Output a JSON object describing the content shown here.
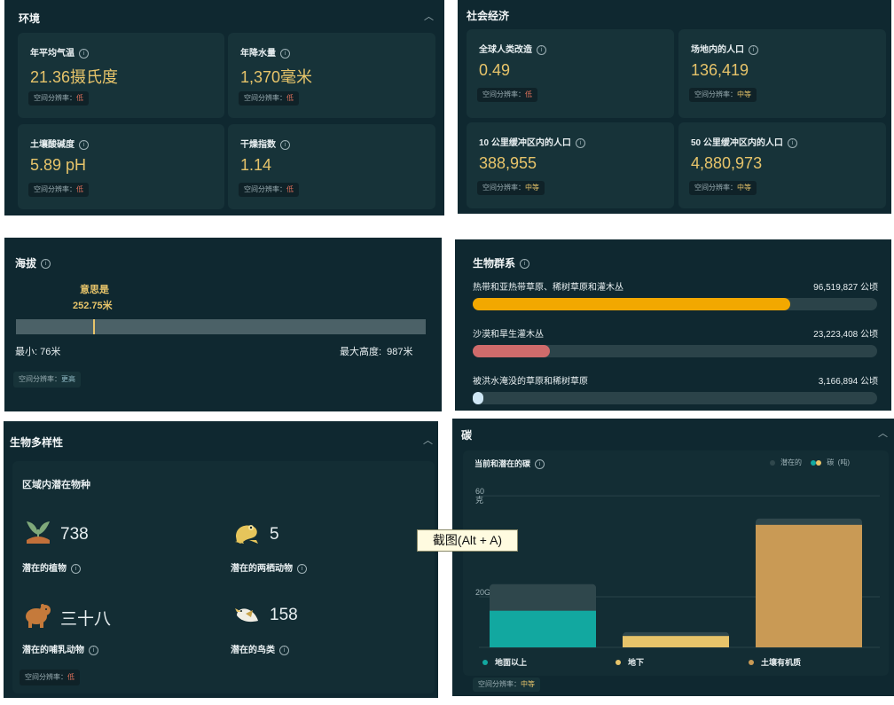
{
  "environment": {
    "title": "环境",
    "cards": [
      {
        "label": "年平均气温",
        "value": "21.36摄氏度",
        "res_label": "空间分辨率：",
        "res_level": "低"
      },
      {
        "label": "年降水量",
        "value": "1,370毫米",
        "res_label": "空间分辨率：",
        "res_level": "低"
      },
      {
        "label": "土壤酸碱度",
        "value": "5.89 pH",
        "res_label": "空间分辨率：",
        "res_level": "低"
      },
      {
        "label": "干燥指数",
        "value": "1.14",
        "res_label": "空间分辨率：",
        "res_level": "低"
      }
    ]
  },
  "socioeconomic": {
    "title": "社会经济",
    "cards": [
      {
        "label": "全球人类改造",
        "value": "0.49",
        "res_label": "空间分辨率：",
        "res_level": "低"
      },
      {
        "label": "场地内的人口",
        "value": "136,419",
        "res_label": "空间分辨率：",
        "res_level": "中等"
      },
      {
        "label": "10 公里缓冲区内的人口",
        "value": "388,955",
        "res_label": "空间分辨率：",
        "res_level": "中等"
      },
      {
        "label": "50 公里缓冲区内的人口",
        "value": "4,880,973",
        "res_label": "空间分辨率：",
        "res_level": "中等"
      }
    ]
  },
  "elevation": {
    "title": "海拔",
    "mean_label": "意思是",
    "mean_value": "252.75米",
    "mean_fraction": 0.19,
    "min_label": "最小: 76米",
    "max_label": "最大高度:  987米",
    "res_label": "空间分辨率：",
    "res_level": "更高"
  },
  "biome": {
    "title": "生物群系",
    "rows": [
      {
        "label": "热带和亚热带草原、稀树草原和灌木丛",
        "value": "96,519,827 公顷",
        "fraction": 0.785,
        "color": "#f2a800"
      },
      {
        "label": "沙漠和旱生灌木丛",
        "value": "23,223,408 公顷",
        "fraction": 0.19,
        "color": "#cf6b6b"
      },
      {
        "label": "被洪水淹没的草原和稀树草原",
        "value": "3,166,894 公顷",
        "fraction": 0.026,
        "color": "#cfe7f5"
      }
    ]
  },
  "biodiversity": {
    "title": "生物多样性",
    "subtitle": "区域内潜在物种",
    "items": [
      {
        "count": "738",
        "label": "潜在的植物",
        "icon": "plant-icon"
      },
      {
        "count": "5",
        "label": "潜在的两栖动物",
        "icon": "frog-icon"
      },
      {
        "count": "三十八",
        "label": "潜在的哺乳动物",
        "icon": "bear-icon"
      },
      {
        "count": "158",
        "label": "潜在的鸟类",
        "icon": "bird-icon"
      }
    ],
    "res_label": "空间分辨率：",
    "res_level": "低"
  },
  "carbon": {
    "title": "碳",
    "chart_title": "当前和潜在的碳",
    "legend_potential": "潜在的",
    "legend_carbon": "碳  (吨)",
    "res_label": "空间分辨率：",
    "res_level": "中等",
    "chart_data": {
      "type": "bar",
      "categories": [
        "地面以上",
        "地下",
        "土壤有机质"
      ],
      "y_tick_labels": [
        "60\n克",
        "20G"
      ],
      "ylim": [
        0,
        66
      ],
      "series": [
        {
          "name": "潜在的",
          "values": [
            25,
            6,
            51
          ]
        },
        {
          "name": "碳  (吨)",
          "values": [
            14.5,
            4.5,
            48.5
          ]
        }
      ],
      "colors": [
        "#12a8a0",
        "#e7c46a",
        "#c99a55"
      ]
    }
  },
  "tooltip": "截图(Alt + A)"
}
